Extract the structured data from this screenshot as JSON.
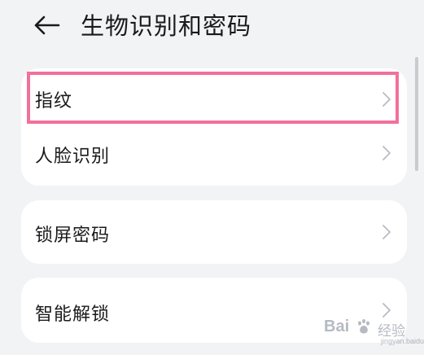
{
  "header": {
    "back_icon": "arrow-left-icon",
    "title": "生物识别和密码"
  },
  "sections": [
    {
      "items": [
        {
          "label": "指纹",
          "icon": "chevron-right-icon",
          "highlighted": true
        },
        {
          "label": "人脸识别",
          "icon": "chevron-right-icon",
          "highlighted": false
        }
      ]
    },
    {
      "items": [
        {
          "label": "锁屏密码",
          "icon": "chevron-right-icon"
        }
      ]
    },
    {
      "items": [
        {
          "label": "智能解锁",
          "icon": "chevron-right-icon"
        }
      ]
    }
  ],
  "highlight": {
    "color": "#f2709a",
    "target": "指纹"
  },
  "colors": {
    "background": "#f1f3f5",
    "card": "#ffffff",
    "text": "#1a1a1a",
    "chevron": "#b8bcc2",
    "highlight": "#f2709a"
  },
  "watermark": {
    "brand": "Bai",
    "suffix": "经验",
    "url": "jingyan.baidu.com"
  }
}
